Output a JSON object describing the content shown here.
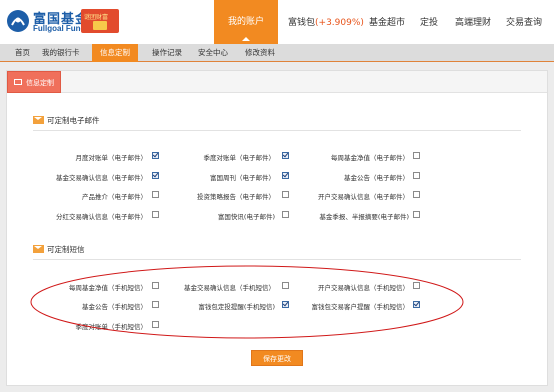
{
  "header": {
    "brand_cn": "富国基金",
    "brand_en": "Fullgoal Fund",
    "promo_text": "谜团财富",
    "nav": {
      "active": "我的账户",
      "item1_prefix": "富钱包",
      "item1_rate": "(+3.909%)",
      "item2": "基金超市",
      "item3": "定投",
      "item4": "高端理财",
      "item5": "交易查询"
    }
  },
  "subnav": {
    "items": [
      "首页",
      "我的银行卡",
      "信息定制",
      "操作记录",
      "安全中心",
      "修改资料"
    ]
  },
  "panel": {
    "tab": "信息定制",
    "email_section": {
      "title": "可定制电子邮件",
      "options": [
        {
          "label": "月度对账单（电子邮件）",
          "checked": true
        },
        {
          "label": "季度对账单（电子邮件）",
          "checked": true
        },
        {
          "label": "每周基金净值（电子邮件）",
          "checked": false
        },
        {
          "label": "基金交易确认信息（电子邮件）",
          "checked": true
        },
        {
          "label": "富国周刊（电子邮件）",
          "checked": true
        },
        {
          "label": "基金公告（电子邮件）",
          "checked": false
        },
        {
          "label": "产品推介（电子邮件）",
          "checked": false
        },
        {
          "label": "投资策略报告（电子邮件）",
          "checked": false
        },
        {
          "label": "开户交易确认信息（电子邮件）",
          "checked": false
        },
        {
          "label": "分红交易确认信息（电子邮件）",
          "checked": false
        },
        {
          "label": "富国快讯(电子邮件)",
          "checked": false
        },
        {
          "label": "基金季报、半报摘要(电子邮件)",
          "checked": false
        }
      ]
    },
    "sms_section": {
      "title": "可定制短信",
      "options": [
        {
          "label": "每周基金净值（手机短信）",
          "checked": false
        },
        {
          "label": "基金交易确认信息（手机短信）",
          "checked": false
        },
        {
          "label": "开户交易确认信息（手机短信）",
          "checked": false
        },
        {
          "label": "基金公告（手机短信）",
          "checked": false
        },
        {
          "label": "富钱包定投提醒(手机短信)",
          "checked": true
        },
        {
          "label": "富钱包交易客户提醒（手机短信）",
          "checked": true
        },
        {
          "label": "季度对账单（手机短信）",
          "checked": false
        }
      ]
    },
    "save_label": "保存更改"
  },
  "colors": {
    "accent": "#f28a21",
    "brand_blue": "#1d5ea8",
    "tab_red": "#f0705b",
    "annotation": "#d01818"
  }
}
